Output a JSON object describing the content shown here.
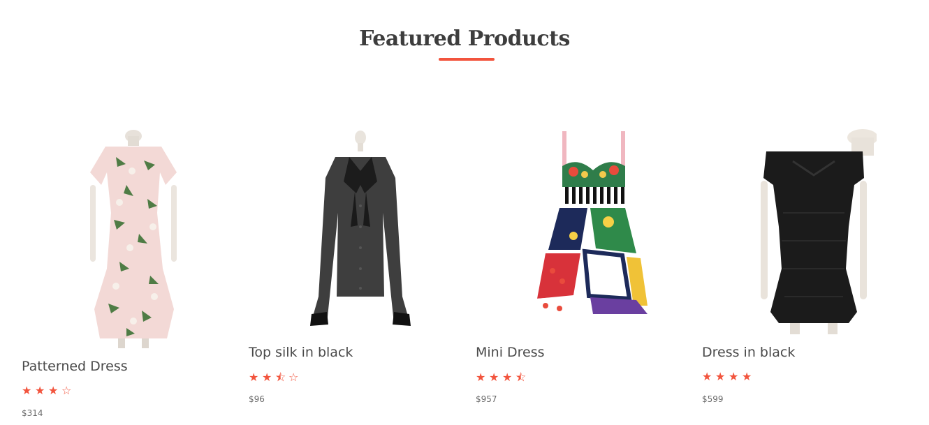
{
  "section": {
    "title": "Featured Products",
    "accent_color": "#f2543d"
  },
  "products": [
    {
      "name": "Patterned Dress",
      "rating": 3,
      "rating_max": 4,
      "price": "$314",
      "image": "floral-dress-on-mannequin"
    },
    {
      "name": "Top silk in black",
      "rating": 2.5,
      "rating_max": 4,
      "price": "$96",
      "image": "sheer-black-blouse-on-mannequin"
    },
    {
      "name": "Mini Dress",
      "rating": 3.5,
      "rating_max": 4,
      "price": "$957",
      "image": "patchwork-mini-dress"
    },
    {
      "name": "Dress in black",
      "rating": 4,
      "rating_max": 4,
      "price": "$599",
      "image": "black-off-shoulder-dress-on-mannequin"
    }
  ]
}
